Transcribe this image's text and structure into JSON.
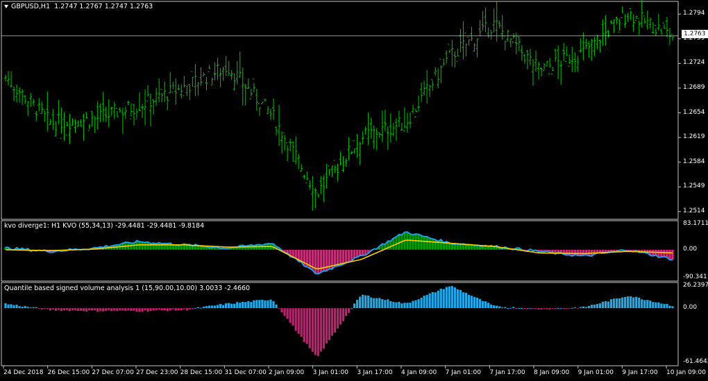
{
  "main_header": {
    "symbol": "GBPUSD,H1",
    "ohlc": "1.2747 1.2767 1.2747 1.2763"
  },
  "current_price": "1.2763",
  "price_axis": [
    "1.2794",
    "1.2759",
    "1.2724",
    "1.2689",
    "1.2654",
    "1.2619",
    "1.2584",
    "1.2549",
    "1.2514"
  ],
  "kvo_header": "kvo diverge1: H1  KVO (55,34,13) -29.4481 -29.4481 -9.8184",
  "kvo_axis": [
    "83.1711",
    "0.00",
    "-90.3411"
  ],
  "vol_header": "Quantile based signed volume analysis 1 (15,90.00,10.00) 3.0033 -2.4660",
  "vol_axis": [
    "26.2397",
    "0.00",
    "-61.4642"
  ],
  "time_axis": [
    "24 Dec 2018",
    "26 Dec 15:00",
    "27 Dec 07:00",
    "27 Dec 23:00",
    "28 Dec 15:00",
    "31 Dec 07:00",
    "2 Jan 09:00",
    "3 Jan 01:00",
    "3 Jan 17:00",
    "4 Jan 09:00",
    "7 Jan 01:00",
    "7 Jan 17:00",
    "8 Jan 09:00",
    "9 Jan 01:00",
    "9 Jan 17:00",
    "10 Jan 09:00"
  ],
  "colors": {
    "candle": "#00c800",
    "kvo_up": "#00a000",
    "kvo_down": "#e0207a",
    "kvo_line": "#1ea0e8",
    "signal_line": "#ffd000",
    "vol_up": "#20a8e8",
    "vol_down": "#c0206e",
    "grid_border": "#c8c8c8"
  },
  "chart_data": [
    {
      "type": "line",
      "title": "GBPUSD,H1",
      "ylim": [
        1.2505,
        1.281
      ],
      "x": [
        "24 Dec 2018",
        "26 Dec 15:00",
        "27 Dec 07:00",
        "27 Dec 23:00",
        "28 Dec 15:00",
        "31 Dec 07:00",
        "2 Jan 09:00",
        "3 Jan 01:00",
        "3 Jan 17:00",
        "4 Jan 09:00",
        "7 Jan 01:00",
        "7 Jan 17:00",
        "8 Jan 09:00",
        "9 Jan 01:00",
        "9 Jan 17:00",
        "10 Jan 09:00"
      ],
      "y": [
        1.2705,
        1.264,
        1.2645,
        1.2665,
        1.269,
        1.272,
        1.265,
        1.254,
        1.262,
        1.264,
        1.2735,
        1.278,
        1.2715,
        1.274,
        1.2795,
        1.2763
      ]
    },
    {
      "type": "bar",
      "title": "KVO (55,34,13)",
      "ylim": [
        -90.3411,
        83.1711
      ],
      "x": [
        "24 Dec 2018",
        "26 Dec 15:00",
        "27 Dec 07:00",
        "27 Dec 23:00",
        "28 Dec 15:00",
        "31 Dec 07:00",
        "2 Jan 09:00",
        "3 Jan 01:00",
        "3 Jan 17:00",
        "4 Jan 09:00",
        "7 Jan 01:00",
        "7 Jan 17:00",
        "8 Jan 09:00",
        "9 Jan 01:00",
        "9 Jan 17:00",
        "10 Jan 09:00"
      ],
      "series": [
        {
          "name": "KVO",
          "values": [
            5,
            -5,
            5,
            25,
            15,
            5,
            20,
            -75,
            -20,
            55,
            20,
            10,
            -5,
            -20,
            0,
            -29.4481
          ]
        },
        {
          "name": "Signal",
          "values": [
            0,
            -3,
            2,
            15,
            15,
            8,
            10,
            -60,
            -30,
            30,
            20,
            10,
            -10,
            -12,
            -5,
            -9.8184
          ]
        }
      ]
    },
    {
      "type": "bar",
      "title": "Quantile based signed volume analysis 1 (15,90.00,10.00)",
      "ylim": [
        -61.4642,
        26.2397
      ],
      "x": [
        "24 Dec 2018",
        "26 Dec 15:00",
        "27 Dec 07:00",
        "27 Dec 23:00",
        "28 Dec 15:00",
        "31 Dec 07:00",
        "2 Jan 09:00",
        "3 Jan 01:00",
        "3 Jan 17:00",
        "4 Jan 09:00",
        "7 Jan 01:00",
        "7 Jan 17:00",
        "8 Jan 09:00",
        "9 Jan 01:00",
        "9 Jan 17:00",
        "10 Jan 09:00"
      ],
      "values": [
        5,
        -2,
        -3,
        -3,
        -2,
        5,
        10,
        -55,
        15,
        5,
        25,
        2,
        -1,
        1,
        14,
        3.0033
      ]
    }
  ]
}
